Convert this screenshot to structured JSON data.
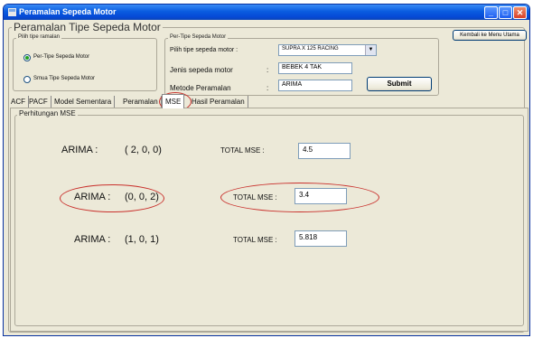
{
  "window": {
    "title": "Peramalan Sepeda Motor",
    "controls": {
      "minimize": "_",
      "maximize": "□",
      "close": "✕"
    }
  },
  "header": {
    "title": "Peramalan Tipe Sepeda Motor",
    "back_button": "Kembali ke Menu Utama"
  },
  "ramalan_group": {
    "label": "Pilih tipe ramalan",
    "options": [
      {
        "label": "Per-Tipe Sepeda Motor",
        "selected": true
      },
      {
        "label": "Smua Tipe Sepeda Motor",
        "selected": false
      }
    ]
  },
  "pertipe_group": {
    "label": "Per-Tipe Sepeda Motor",
    "pilih_label": "Pilih tipe sepeda motor :",
    "pilih_value": "SUPRA X 125 RACING",
    "jenis_label": "Jenis sepeda motor",
    "jenis_colon": ":",
    "jenis_value": "BEBEK 4 TAK",
    "metode_label": "Metode Peramalan",
    "metode_colon": ":",
    "metode_value": "ARIMA",
    "submit": "Submit"
  },
  "tabs": [
    {
      "label": "ACF",
      "active": false
    },
    {
      "label": "PACF",
      "active": false
    },
    {
      "label": "Model Sementara",
      "active": false
    },
    {
      "label": "Peramalan",
      "active": false
    },
    {
      "label": "MSE",
      "active": true
    },
    {
      "label": "Hasil Peramalan",
      "active": false
    }
  ],
  "mse_panel": {
    "label": "Perhitungan MSE",
    "rows": [
      {
        "arima_label": "ARIMA :",
        "order": "( 2, 0, 0)",
        "mse_label": "TOTAL MSE :",
        "mse": "4.5"
      },
      {
        "arima_label": "ARIMA :",
        "order": "(0,  0,  2)",
        "mse_label": "TOTAL MSE :",
        "mse": "3.4"
      },
      {
        "arima_label": "ARIMA :",
        "order": "(1, 0, 1)",
        "mse_label": "TOTAL MSE :",
        "mse": "5.818"
      }
    ]
  },
  "colors": {
    "titlebar": "#0a5ce0",
    "annotation_circle": "#c9302c",
    "window_bg": "#ece9d8"
  }
}
